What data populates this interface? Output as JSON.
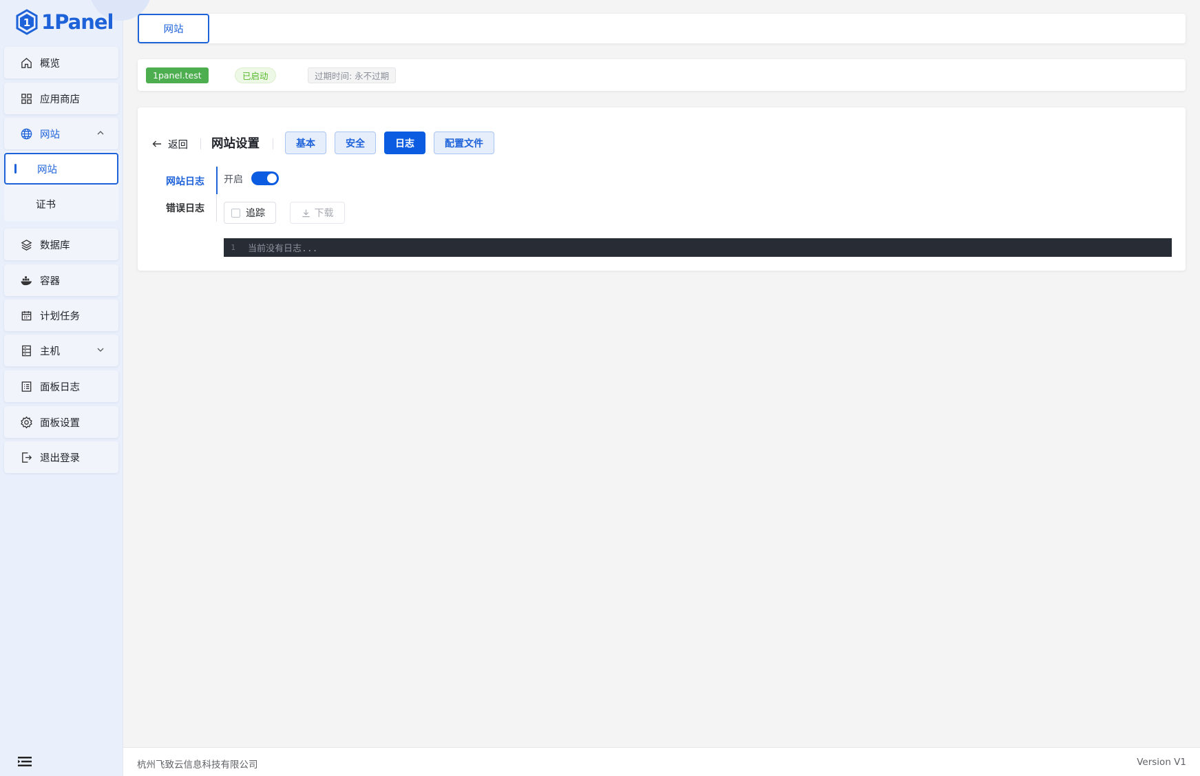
{
  "app": {
    "brand": "1Panel",
    "accent": "#1d62d9"
  },
  "sidebar": {
    "items": [
      {
        "label": "概览",
        "icon": "home-icon"
      },
      {
        "label": "应用商店",
        "icon": "grid-icon"
      },
      {
        "label": "网站",
        "icon": "globe-icon"
      },
      {
        "label": "数据库",
        "icon": "layers-icon"
      },
      {
        "label": "容器",
        "icon": "docker-icon"
      },
      {
        "label": "计划任务",
        "icon": "calendar-icon"
      },
      {
        "label": "主机",
        "icon": "server-icon"
      },
      {
        "label": "面板日志",
        "icon": "log-icon"
      },
      {
        "label": "面板设置",
        "icon": "gear-icon"
      },
      {
        "label": "退出登录",
        "icon": "logout-icon"
      }
    ],
    "website_sub": [
      {
        "label": "网站"
      },
      {
        "label": "证书"
      }
    ]
  },
  "header": {
    "tab": "网站"
  },
  "info": {
    "domain": "1panel.test",
    "status": "已启动",
    "expire": "过期时间: 永不过期"
  },
  "settings": {
    "back_label": "返回",
    "title": "网站设置",
    "tabs": [
      {
        "label": "基本"
      },
      {
        "label": "安全"
      },
      {
        "label": "日志"
      },
      {
        "label": "配置文件"
      }
    ],
    "log_nav": [
      {
        "label": "网站日志"
      },
      {
        "label": "错误日志"
      }
    ],
    "switch_label": "开启",
    "switch_on": true,
    "track_label": "追踪",
    "download_label": "下载",
    "editor": {
      "line": "1",
      "text": "当前没有日志..."
    }
  },
  "footer": {
    "company": "杭州飞致云信息科技有限公司",
    "version": "Version V1"
  }
}
